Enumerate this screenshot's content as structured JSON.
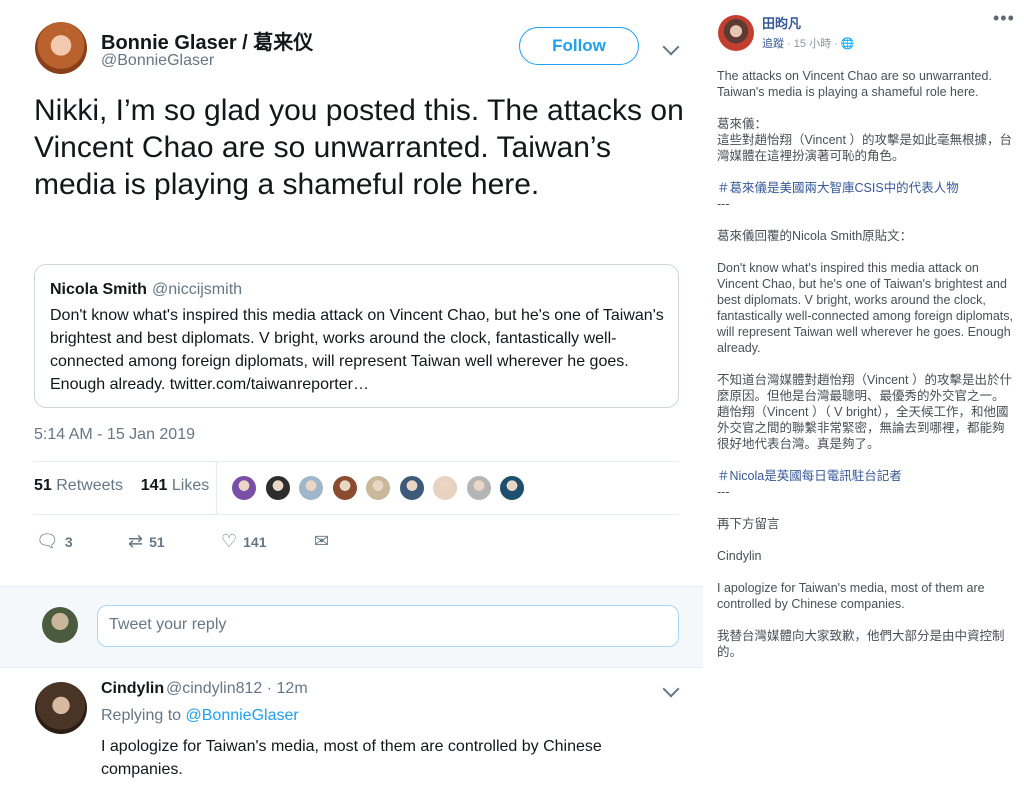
{
  "tweet": {
    "author_name": "Bonnie Glaser / 葛来仪",
    "author_handle": "@BonnieGlaser",
    "follow_label": "Follow",
    "text": "Nikki, I’m so glad you posted this. The attacks on Vincent Chao are so unwarranted. Taiwan’s media is playing a shameful role here.",
    "quote": {
      "name": "Nicola Smith",
      "handle": "@niccijsmith",
      "text": "Don't know what's inspired this media attack on Vincent Chao, but he's one of Taiwan's brightest and best diplomats. V bright, works around the clock, fantastically well-connected among foreign diplomats, will represent Taiwan well wherever he goes. Enough already. twitter.com/taiwanreporter…"
    },
    "timestamp": "5:14 AM - 15 Jan 2019",
    "retweets_count": "51",
    "retweets_label": "Retweets",
    "likes_count": "141",
    "likes_label": "Likes",
    "actions": {
      "reply_count": "3",
      "retweet_count": "51",
      "like_count": "141"
    },
    "likers_colors": [
      "#7b4fa8",
      "#2d2d2d",
      "#9fb7c8",
      "#8a4b2e",
      "#c9b89a",
      "#3e5a7a",
      "#e8d2c0",
      "#b5b5b5",
      "#1f4f6e"
    ]
  },
  "reply_box": {
    "placeholder": "Tweet your reply"
  },
  "reply": {
    "name": "Cindylin",
    "handle": "@cindylin812 · 12m",
    "replying_prefix": "Replying to",
    "replying_to": "@BonnieGlaser",
    "text": "I apologize for Taiwan's media, most of them are controlled by Chinese companies."
  },
  "fb_post": {
    "author": "田昀凡",
    "follow": "追蹤",
    "time": "· 15 小時 ·",
    "globe": "🌐",
    "dots": "•••",
    "p1": "The attacks on Vincent Chao are so unwarranted. Taiwan's media is playing a shameful role here.",
    "p2": "葛來儀：\n這些對趙怡翔（Vincent ）的攻擊是如此毫無根據，台灣媒體在這裡扮演著可恥的角色。",
    "tag1": "＃葛來儀是美國兩大智庫CSIS中的代表人物",
    "dash1": "---",
    "p3": "葛來儀回覆的Nicola Smith原貼文：",
    "p4": "Don't know what's inspired this media attack on Vincent Chao, but he's one of Taiwan's brightest and best diplomats. V bright, works around the clock, fantastically well-connected among foreign diplomats, will represent Taiwan well wherever he goes. Enough already.",
    "p5": "不知道台灣媒體對趙怡翔（Vincent ）的攻擊是出於什麼原因。但他是台灣最聰明、最優秀的外交官之一。趙怡翔（Vincent ）（ V bright），全天候工作，和他國外交官之間的聯繫非常緊密，無論去到哪裡，都能夠很好地代表台灣。真是夠了。",
    "tag2": "＃Nicola是英國每日電訊駐台記者",
    "dash2": "---",
    "p6": "再下方留言",
    "p7": "Cindylin",
    "p8": "I apologize for Taiwan's media, most of them are controlled by Chinese companies.",
    "p9": "我替台灣媒體向大家致歉，他們大部分是由中資控制的。"
  }
}
